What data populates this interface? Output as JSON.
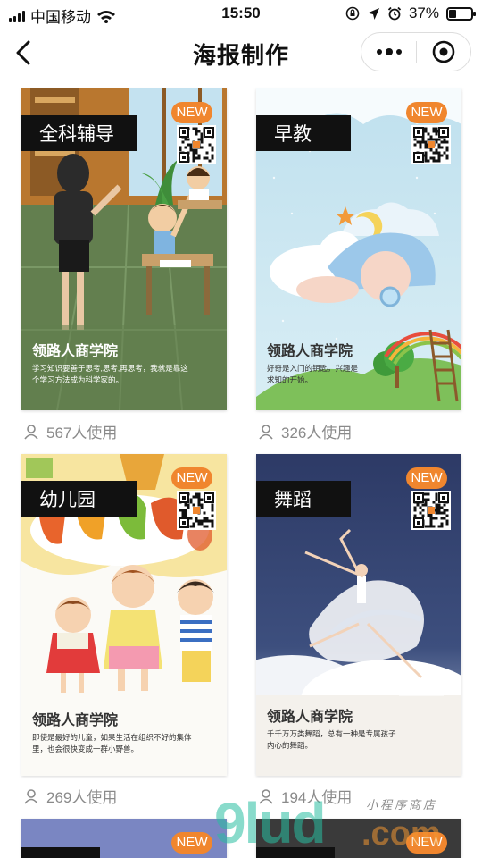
{
  "status_bar": {
    "carrier": "中国移动",
    "time": "15:50",
    "battery_text": "37%",
    "battery_level": 0.37
  },
  "nav": {
    "title": "海报制作"
  },
  "posters": [
    {
      "tag": "全科辅导",
      "badge": "NEW",
      "school": "领路人商学院",
      "desc": "学习知识要善于思考,思考,再思考，我就是靠这个学习方法成为科学家的。",
      "usage": "567人使用"
    },
    {
      "tag": "早教",
      "badge": "NEW",
      "school": "领路人商学院",
      "desc": "好奇是入门的钥匙，兴趣是求知的开始。",
      "usage": "326人使用"
    },
    {
      "tag": "幼儿园",
      "badge": "NEW",
      "school": "领路人商学院",
      "desc": "即使是最好的儿童，如果生活在组织不好的集体里，也会很快变成一群小野兽。",
      "usage": "269人使用"
    },
    {
      "tag": "舞蹈",
      "badge": "NEW",
      "school": "领路人商学院",
      "desc": "千千万万类舞蹈，总有一种是专属孩子内心的舞蹈。",
      "usage": "194人使用"
    },
    {
      "tag": "",
      "badge": "NEW"
    },
    {
      "tag": "",
      "badge": "NEW"
    }
  ],
  "watermark": {
    "main": "9lud",
    "sub": "小程序商店",
    "domain": ".com"
  },
  "colors": {
    "badge": "#f0862e",
    "tag_bg": "#111111",
    "usage_text": "#8a8a8a"
  },
  "icons": [
    "signal-icon",
    "wifi-icon",
    "lock-rotation-icon",
    "location-icon",
    "alarm-icon",
    "battery-icon",
    "back-arrow-icon",
    "more-dots-icon",
    "close-target-icon",
    "user-icon",
    "qr-code-icon"
  ]
}
